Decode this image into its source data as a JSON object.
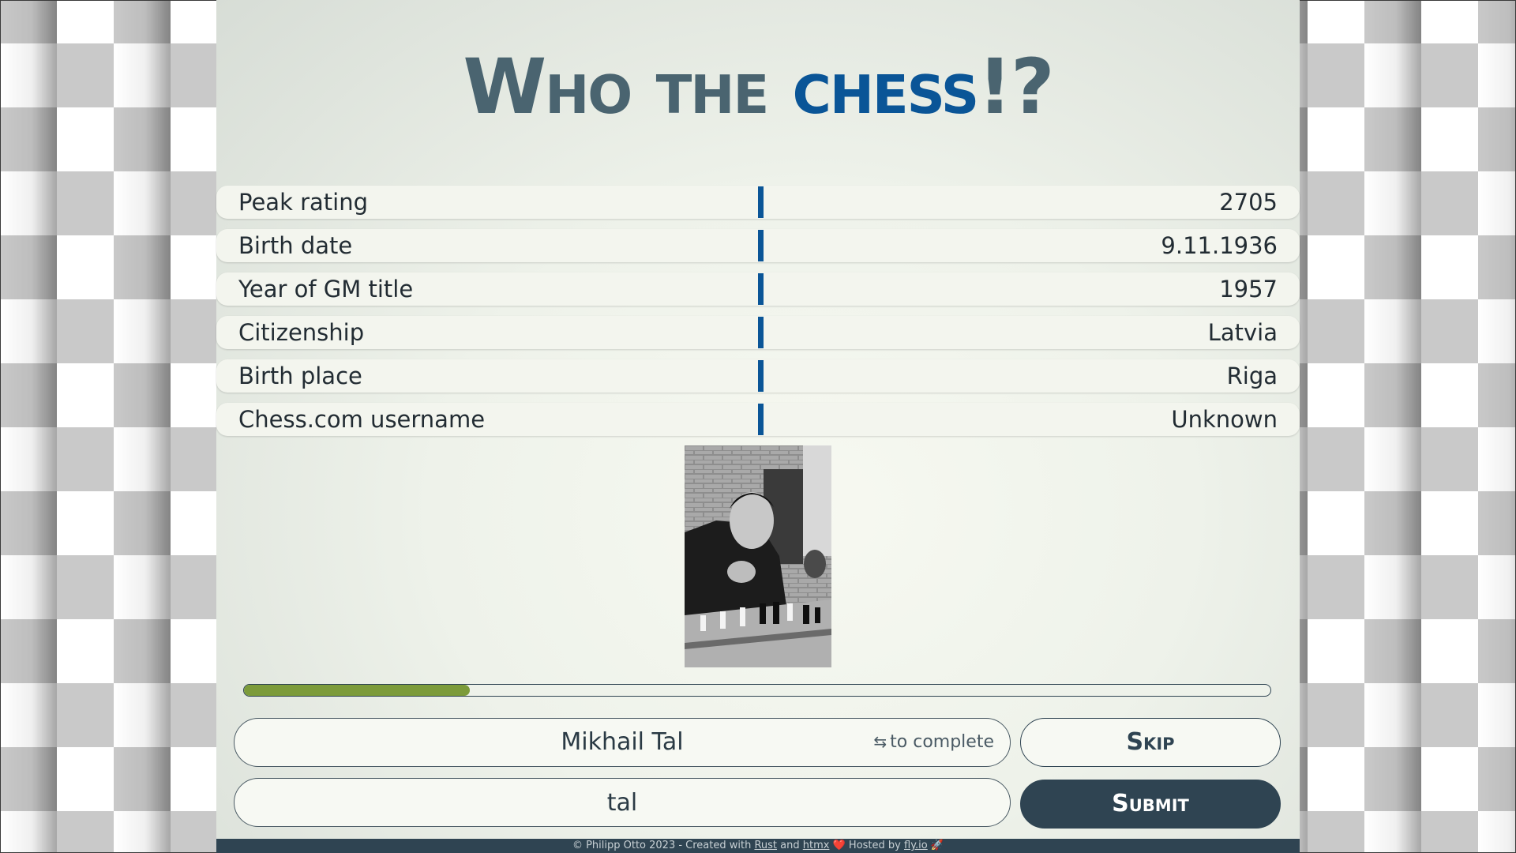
{
  "header": {
    "title_part1": "Who the ",
    "title_part2": "chess",
    "title_part3": "!?"
  },
  "stats": [
    {
      "label": "Peak rating",
      "value": "2705"
    },
    {
      "label": "Birth date",
      "value": "9.11.1936"
    },
    {
      "label": "Year of GM title",
      "value": "1957"
    },
    {
      "label": "Citizenship",
      "value": "Latvia"
    },
    {
      "label": "Birth place",
      "value": "Riga"
    },
    {
      "label": "Chess.com username",
      "value": "Unknown"
    }
  ],
  "photo": {
    "description_icon": "player-photo"
  },
  "progress": {
    "fraction": 0.22
  },
  "suggestion": {
    "text": "Mikhail Tal",
    "hint_icon": "swap-arrows",
    "hint": "to complete"
  },
  "guess_input": {
    "value": "tal"
  },
  "buttons": {
    "skip": "Skip",
    "submit": "Submit"
  },
  "footer": {
    "prefix": "© Philipp Otto 2023 - Created with ",
    "link_rust": "Rust",
    "and": " and ",
    "link_htmx": "htmx",
    "heart": "❤️",
    "hosted": " Hosted by ",
    "link_fly": "fly.io",
    "rocket": "🚀"
  },
  "colors": {
    "accent": "#0a5597",
    "dark": "#2f4452",
    "progress": "#7c9b3a"
  }
}
